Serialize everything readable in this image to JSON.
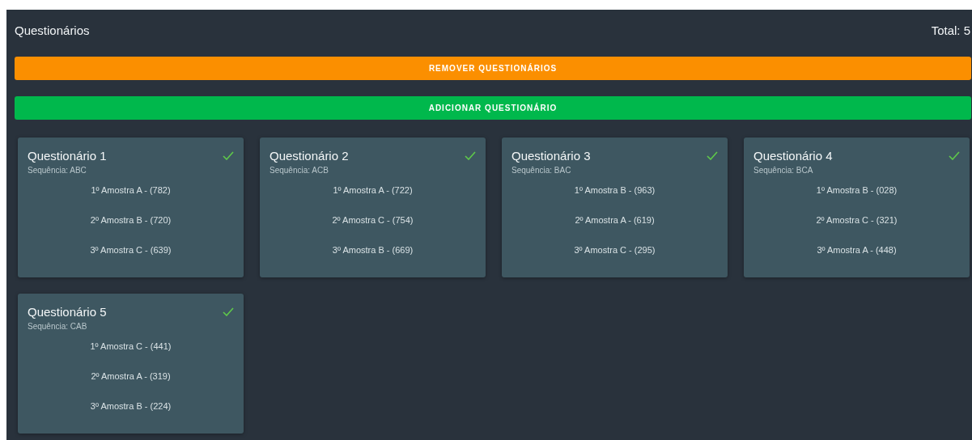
{
  "header": {
    "title": "Questionários",
    "total": "Total: 5"
  },
  "buttons": [
    {
      "label": "REMOVER QUESTIONÁRIOS",
      "kind": "remove"
    },
    {
      "label": "ADICIONAR QUESTIONÁRIO",
      "kind": "add"
    }
  ],
  "questionnaires": [
    {
      "title": "Questionário 1",
      "sequence": "Sequência: ABC",
      "completed": true,
      "samples": [
        "1º Amostra A - (782)",
        "2º Amostra B - (720)",
        "3º Amostra C - (639)"
      ]
    },
    {
      "title": "Questionário 2",
      "sequence": "Sequência: ACB",
      "completed": true,
      "samples": [
        "1º Amostra A - (722)",
        "2º Amostra C - (754)",
        "3º Amostra B - (669)"
      ]
    },
    {
      "title": "Questionário 3",
      "sequence": "Sequência: BAC",
      "completed": true,
      "samples": [
        "1º Amostra B - (963)",
        "2º Amostra A - (619)",
        "3º Amostra C - (295)"
      ]
    },
    {
      "title": "Questionário 4",
      "sequence": "Sequência: BCA",
      "completed": true,
      "samples": [
        "1º Amostra B - (028)",
        "2º Amostra C - (321)",
        "3º Amostra A - (448)"
      ]
    },
    {
      "title": "Questionário 5",
      "sequence": "Sequência: CAB",
      "completed": true,
      "samples": [
        "1º Amostra C - (441)",
        "2º Amostra A - (319)",
        "3º Amostra B - (224)"
      ]
    }
  ]
}
